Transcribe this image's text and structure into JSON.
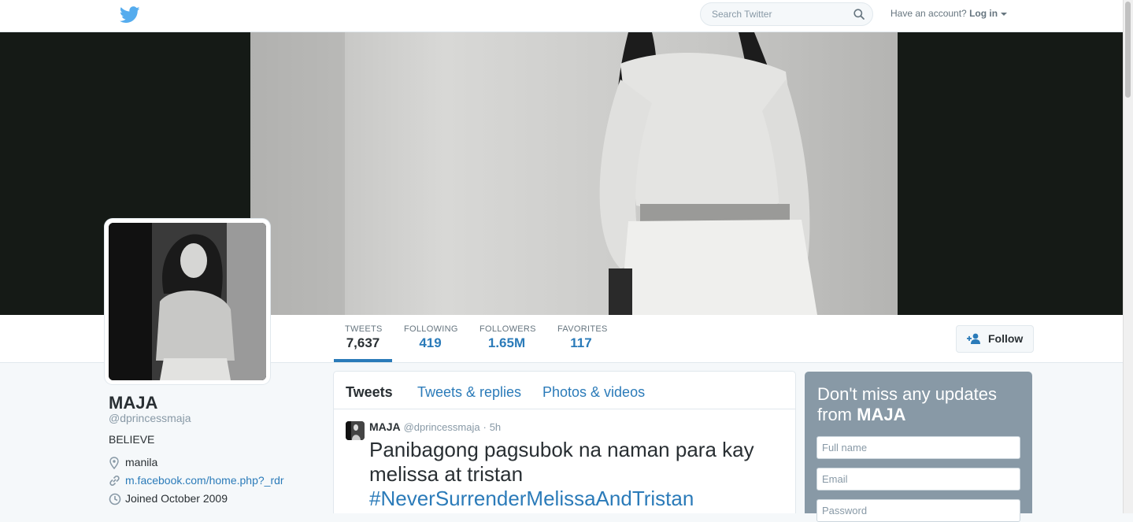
{
  "nav": {
    "search_placeholder": "Search Twitter",
    "account_prompt": "Have an account?",
    "login_label": "Log in"
  },
  "profile": {
    "name": "MAJA",
    "handle": "@dprincessmaja",
    "bio": "BELIEVE",
    "location": "manila",
    "website": "m.facebook.com/home.php?_rdr",
    "joined": "Joined October 2009"
  },
  "stats": [
    {
      "label": "TWEETS",
      "value": "7,637"
    },
    {
      "label": "FOLLOWING",
      "value": "419"
    },
    {
      "label": "FOLLOWERS",
      "value": "1.65M"
    },
    {
      "label": "FAVORITES",
      "value": "117"
    }
  ],
  "follow_label": "Follow",
  "tabs": [
    "Tweets",
    "Tweets & replies",
    "Photos & videos"
  ],
  "tweet": {
    "name": "MAJA",
    "handle": "@dprincessmaja",
    "separator": "·",
    "time": "5h",
    "text": "Panibagong pagsubok na naman para kay melissa at tristan",
    "hashtag": "#NeverSurrenderMelissaAndTristan"
  },
  "signup": {
    "heading_prefix": "Don't miss any updates from",
    "heading_name": "MAJA",
    "fullname_placeholder": "Full name",
    "email_placeholder": "Email",
    "password_placeholder": "Password"
  },
  "colors": {
    "link_blue": "#2b7bb9",
    "twitter_blue": "#55acee",
    "signup_bg": "#8899a6"
  }
}
